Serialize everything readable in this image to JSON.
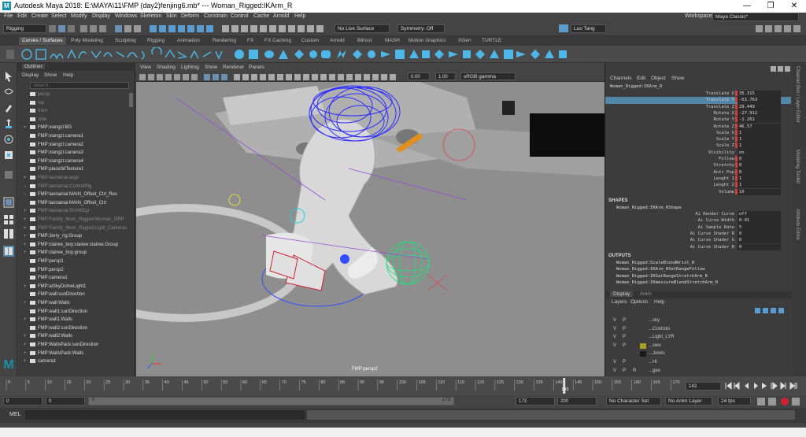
{
  "window": {
    "title": "Autodesk Maya 2018: E:\\MAYA\\11\\FMP  (day2)fenjing6.mb*   ---   Woman_Rigged:IKArm_R",
    "logo": "M",
    "minimize": "—",
    "maximize": "❐",
    "close": "✕"
  },
  "menubar": {
    "items": [
      "File",
      "Edit",
      "Create",
      "Select",
      "Modify",
      "Display",
      "Windows",
      "Skeleton",
      "Skin",
      "Deform",
      "Constrain",
      "Control",
      "Cache",
      "Arnold",
      "Help"
    ],
    "workspace_label": "Workspace :",
    "workspace_value": "Maya Classic*"
  },
  "statusline": {
    "mode": "Rigging",
    "live_surface": "No Live Surface",
    "symmetry": "Symmetry: Off",
    "user": "Luo Tang"
  },
  "shelf": {
    "tabs": [
      "Curves / Surfaces",
      "Poly Modeling",
      "Sculpting",
      "Rigging",
      "Animation",
      "Rendering",
      "FX",
      "FX Caching",
      "Custom",
      "Arnold",
      "Bifrost",
      "MASH",
      "Motion Graphics",
      "XGen",
      "TURTLE"
    ],
    "active_tab": 0
  },
  "outliner": {
    "title": "Outliner",
    "menu": [
      "Display",
      "Show",
      "Help"
    ],
    "search_placeholder": "Search...",
    "rows": [
      {
        "label": "persp",
        "dim": true,
        "expand": ""
      },
      {
        "label": "top",
        "dim": true,
        "expand": ""
      },
      {
        "label": "front",
        "dim": true,
        "expand": ""
      },
      {
        "label": "side",
        "dim": true,
        "expand": ""
      },
      {
        "label": "FMP:xiangzi:BG",
        "dim": false,
        "expand": "+"
      },
      {
        "label": "FMP:xiangzi:camera1",
        "dim": false,
        "expand": ""
      },
      {
        "label": "FMP:xiangzi:camera2",
        "dim": false,
        "expand": ""
      },
      {
        "label": "FMP:xiangzi:camera3",
        "dim": false,
        "expand": ""
      },
      {
        "label": "FMP:xiangzi:camera4",
        "dim": false,
        "expand": ""
      },
      {
        "label": "FMP:place3dTexture1",
        "dim": false,
        "expand": ""
      },
      {
        "label": "FMP:laonainai:argo",
        "dim": true,
        "expand": "+"
      },
      {
        "label": "FMP:laonainai:ControlRig",
        "dim": true,
        "expand": "−"
      },
      {
        "label": "FMP:laonainai:MAIN_Offset_Ctrl_Res",
        "dim": false,
        "expand": "−"
      },
      {
        "label": "FMP:laonainai:MAIN_Offset_Ctrl",
        "dim": false,
        "expand": ""
      },
      {
        "label": "FMP:laonainai:SHAKEgr",
        "dim": true,
        "expand": "+"
      },
      {
        "label": "FMP:Family_Mum_Rigged:Woman_GRP",
        "dim": true,
        "expand": "+"
      },
      {
        "label": "FMP:Family_Mum_Rigged:Light_Cameras",
        "dim": true,
        "expand": "+"
      },
      {
        "label": "FMP:Jerry_rig:Group",
        "dim": false,
        "expand": "+"
      },
      {
        "label": "FMP:clairee_boy:clairee:clairee:Group",
        "dim": false,
        "expand": "+"
      },
      {
        "label": "FMP:clairee_boy:group",
        "dim": false,
        "expand": "+"
      },
      {
        "label": "FMP:persp1",
        "dim": false,
        "expand": ""
      },
      {
        "label": "FMP:persp2",
        "dim": false,
        "expand": ""
      },
      {
        "label": "FMP:camera1",
        "dim": false,
        "expand": ""
      },
      {
        "label": "FMP:aiSkyDomeLight1",
        "dim": false,
        "expand": "+"
      },
      {
        "label": "FMP:wall:sunDirection",
        "dim": false,
        "expand": ""
      },
      {
        "label": "FMP:wall:Walls",
        "dim": false,
        "expand": "+"
      },
      {
        "label": "FMP:wall1:sunDirection",
        "dim": false,
        "expand": ""
      },
      {
        "label": "FMP:wall1:Walls",
        "dim": false,
        "expand": "+"
      },
      {
        "label": "FMP:wall2:sunDirection",
        "dim": false,
        "expand": ""
      },
      {
        "label": "FMP:wall2:Walls",
        "dim": false,
        "expand": "+"
      },
      {
        "label": "FMP:WallsPack:sunDirection",
        "dim": false,
        "expand": "+"
      },
      {
        "label": "FMP:WallsPack:Walls",
        "dim": false,
        "expand": "+"
      },
      {
        "label": "camera1",
        "dim": false,
        "expand": "+"
      }
    ]
  },
  "viewport": {
    "menu": [
      "View",
      "Shading",
      "Lighting",
      "Show",
      "Renderer",
      "Panels"
    ],
    "exposure": "0.00",
    "gamma": "1.00",
    "colorspace": "sRGB gamma",
    "camera_label": "FMP:persp2"
  },
  "channelbox": {
    "menu": [
      "Channels",
      "Edit",
      "Object",
      "Show"
    ],
    "object": "Woman_Rigged:IKArm_R",
    "channels": [
      {
        "name": "Translate X",
        "value": "35.315",
        "key": true
      },
      {
        "name": "Translate Y",
        "value": "-63.763",
        "key": true,
        "selected": true
      },
      {
        "name": "Translate Z",
        "value": "29.449",
        "key": true
      },
      {
        "name": "Rotate X",
        "value": "-27.912",
        "key": true
      },
      {
        "name": "Rotate Y",
        "value": "-1.261",
        "key": true
      },
      {
        "name": "Rotate Z",
        "value": "46.57",
        "key": true
      },
      {
        "name": "Scale X",
        "value": "1",
        "key": true
      },
      {
        "name": "Scale Y",
        "value": "1",
        "key": true
      },
      {
        "name": "Scale Z",
        "value": "1",
        "key": true
      },
      {
        "name": "Visibility",
        "value": "on",
        "key": false
      },
      {
        "name": "Follow",
        "value": "0",
        "key": true
      },
      {
        "name": "Stretchy",
        "value": "0",
        "key": true
      },
      {
        "name": "Anti Pop",
        "value": "0",
        "key": true
      },
      {
        "name": "Lenght 1",
        "value": "1",
        "key": true
      },
      {
        "name": "Lenght 2",
        "value": "1",
        "key": true
      },
      {
        "name": "Volume",
        "value": "10",
        "key": true
      }
    ],
    "shapes_header": "SHAPES",
    "shape_name": "Woman_Rigged:IKArm_RShape",
    "shape_channels": [
      {
        "name": "Ai Render Curve",
        "value": "off"
      },
      {
        "name": "Ai Curve Width",
        "value": "0.01"
      },
      {
        "name": "Ai Sample Rate",
        "value": "5"
      },
      {
        "name": "Ai Curve Shader R",
        "value": "0"
      },
      {
        "name": "Ai Curve Shader G",
        "value": "0"
      },
      {
        "name": "Ai Curve Shader B",
        "value": "0"
      }
    ],
    "outputs_header": "OUTPUTS",
    "outputs": [
      "Woman_Rigged:ScaleBlendWrist_R",
      "Woman_Rigged:IKArm_RSetRangeFollow",
      "Woman_Rigged:IKSetRangeStretchArm_R",
      "Woman_Rigged:IKmessureBlendStretchArm_R"
    ]
  },
  "layers": {
    "tabs": [
      "Display",
      "Anim"
    ],
    "menu": [
      "Layers",
      "Options",
      "Help"
    ],
    "rows": [
      {
        "v": "V",
        "p": "P",
        "r": "",
        "color": "#3c3c3c",
        "name": "...sky"
      },
      {
        "v": "V",
        "p": "P",
        "r": "",
        "color": "#3c3c3c",
        "name": "...Controls"
      },
      {
        "v": "V",
        "p": "P",
        "r": "",
        "color": "#3c3c3c",
        "name": "...Light_LYR"
      },
      {
        "v": "V",
        "p": "P",
        "r": "",
        "color": "#a8a020",
        "name": "...swu"
      },
      {
        "v": "",
        "p": "",
        "r": "",
        "color": "#1a1a1a",
        "name": "...Joints"
      },
      {
        "v": "V",
        "p": "P",
        "r": "",
        "color": "#3c3c3c",
        "name": "...Hi"
      },
      {
        "v": "V",
        "p": "P",
        "r": "R",
        "color": "#3c3c3c",
        "name": "...geo"
      }
    ]
  },
  "rightstrip": {
    "labels": [
      "Channel Box / Layer Editor",
      "Modeling Toolkit",
      "Attribute Editor"
    ]
  },
  "timeline": {
    "ticks": [
      "0",
      "5",
      "10",
      "15",
      "20",
      "25",
      "30",
      "35",
      "40",
      "45",
      "50",
      "55",
      "60",
      "65",
      "70",
      "75",
      "80",
      "85",
      "90",
      "95",
      "100",
      "105",
      "110",
      "115",
      "120",
      "125",
      "130",
      "135",
      "140",
      "145",
      "150",
      "155",
      "160",
      "165",
      "170"
    ],
    "current_frame": "143",
    "current_frame_field": "143",
    "current_frame_progress": 0.8266
  },
  "range": {
    "start": "0",
    "range_start": "0",
    "slider_start": "0",
    "slider_end": "173",
    "range_end": "173",
    "end": "200",
    "character_set": "No Character Set",
    "anim_layer": "No Anim Layer",
    "fps": "24 fps"
  },
  "commandline": {
    "label": "MEL"
  },
  "colors": {
    "accent": "#5285a6",
    "key": "#d04040",
    "selected_row": "#5285a6",
    "brand": "#1a8fa8"
  }
}
